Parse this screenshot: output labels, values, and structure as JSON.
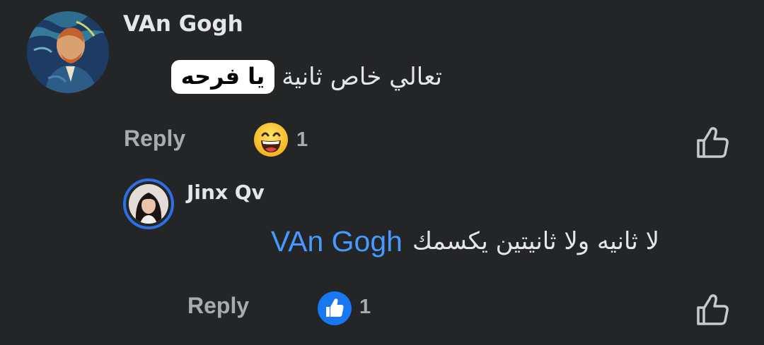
{
  "comment": {
    "author": "VAn Gogh",
    "text_before_tag": "تعالي خاص ثانية",
    "tag": "يا فرحه",
    "reply_label": "Reply",
    "reaction_icon": "laughing-emoji-icon",
    "reaction_count": "1",
    "like_icon": "thumbs-up-outline-icon"
  },
  "reply": {
    "author": "Jinx Qv",
    "text": "لا ثانيه ولا ثانيتين يكسمك",
    "mention": "VAn Gogh",
    "reply_label": "Reply",
    "reaction_icon": "like-reaction-icon",
    "reaction_count": "1",
    "like_icon": "thumbs-up-outline-icon"
  },
  "colors": {
    "background": "#242526",
    "text": "#e4e6eb",
    "secondary_text": "#a8abaf",
    "mention": "#4599ff",
    "like_blue": "#1877f2",
    "avatar_ring": "#2d6fe6"
  }
}
